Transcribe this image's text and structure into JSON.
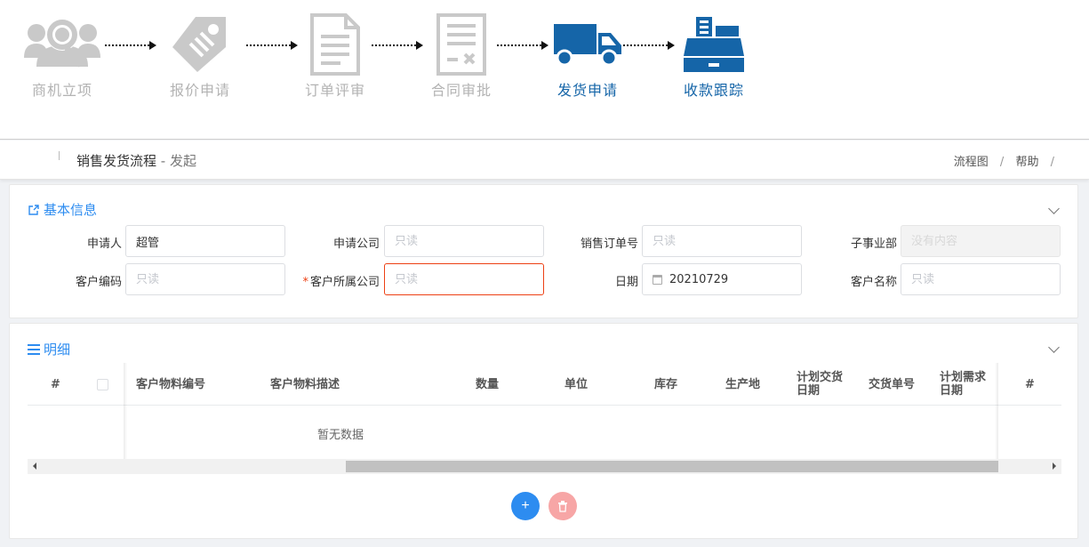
{
  "steps": [
    {
      "label": "商机立项",
      "icon": "user-search-icon",
      "active": false
    },
    {
      "label": "报价申请",
      "icon": "price-tag-icon",
      "active": false
    },
    {
      "label": "订单评审",
      "icon": "document-icon",
      "active": false
    },
    {
      "label": "合同审批",
      "icon": "contract-icon",
      "active": false
    },
    {
      "label": "发货申请",
      "icon": "truck-icon",
      "active": true
    },
    {
      "label": "收款跟踪",
      "icon": "cash-register-icon",
      "active": true
    }
  ],
  "colors": {
    "active": "#1565a8",
    "inactive": "#b3b3b3",
    "accent": "#2d8cf0",
    "danger": "#ed4014"
  },
  "header": {
    "title": "销售发货流程",
    "subtitle": " - 发起",
    "links": [
      "流程图",
      "帮助"
    ],
    "separator": "/"
  },
  "basic_info": {
    "title": "基本信息",
    "fields": {
      "applicant": {
        "label": "申请人",
        "value": "超管",
        "placeholder": ""
      },
      "apply_company": {
        "label": "申请公司",
        "value": "",
        "placeholder": "只读"
      },
      "sales_order_no": {
        "label": "销售订单号",
        "value": "",
        "placeholder": "只读"
      },
      "sub_division": {
        "label": "子事业部",
        "value": "",
        "placeholder": "没有内容"
      },
      "customer_code": {
        "label": "客户编码",
        "value": "",
        "placeholder": "只读"
      },
      "customer_company": {
        "label": "客户所属公司",
        "value": "",
        "placeholder": "只读",
        "required_mark": "*"
      },
      "date": {
        "label": "日期",
        "value": "20210729",
        "placeholder": ""
      },
      "customer_name": {
        "label": "客户名称",
        "value": "",
        "placeholder": "只读"
      }
    }
  },
  "detail": {
    "title": "明细",
    "columns": {
      "index": "#",
      "material_code": "客户物料编号",
      "material_desc": "客户物料描述",
      "quantity": "数量",
      "unit": "单位",
      "stock": "库存",
      "origin": "生产地",
      "plan_delivery_date": "计划交货日期",
      "delivery_no": "交货单号",
      "plan_demand_date": "计划需求日期",
      "action": "#"
    },
    "empty_text": "暂无数据",
    "add_label": "+",
    "delete_label": "🗑"
  }
}
